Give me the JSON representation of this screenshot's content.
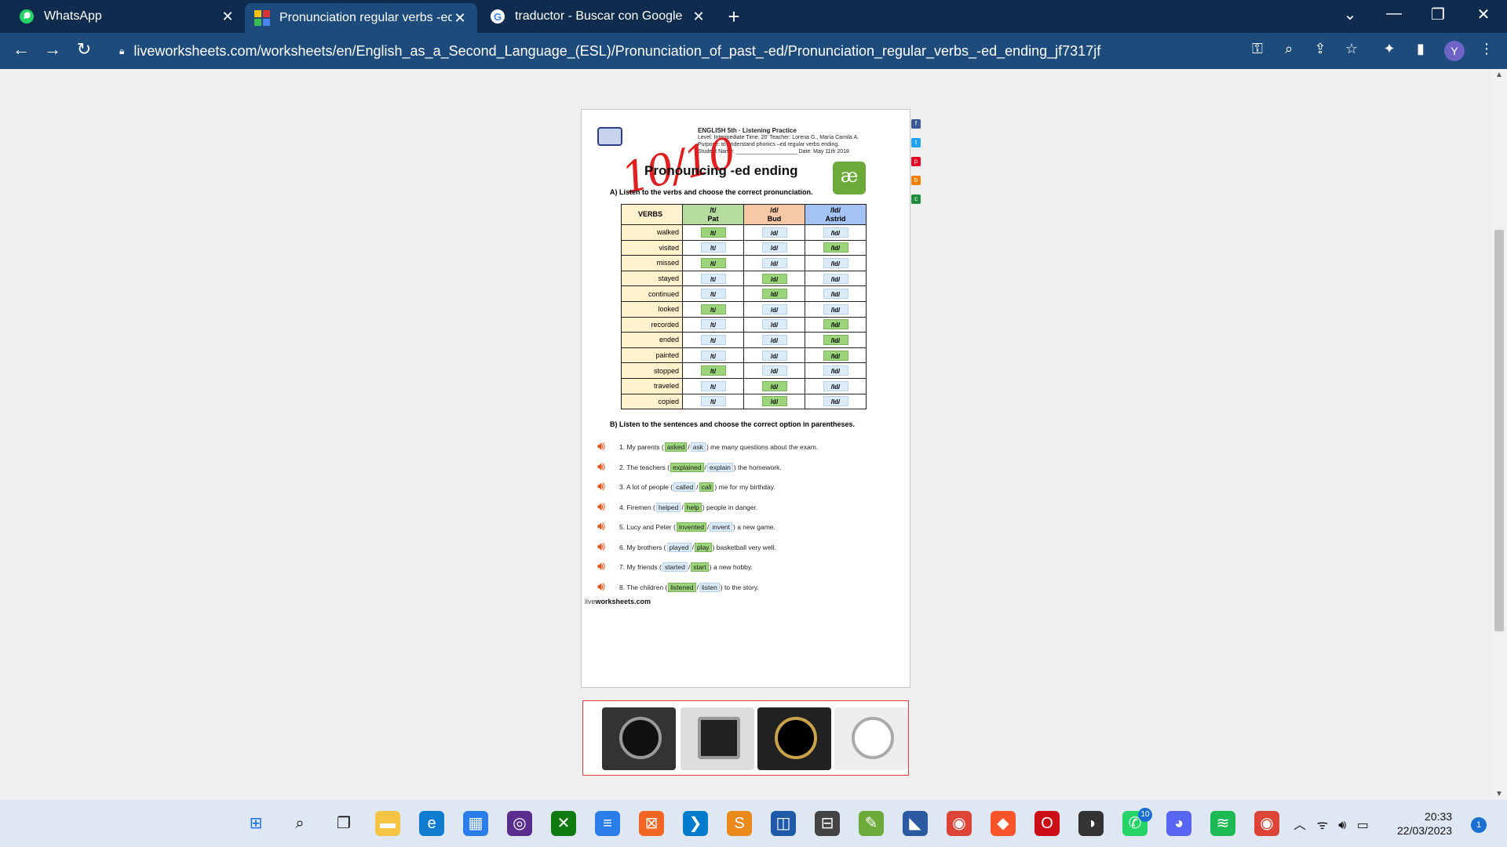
{
  "browser": {
    "tabs": [
      {
        "label": "WhatsApp",
        "icon": "whatsapp-icon"
      },
      {
        "label": "Pronunciation regular verbs -ed e",
        "icon": "liveworksheets-icon",
        "active": true
      },
      {
        "label": "traductor - Buscar con Google",
        "icon": "google-icon"
      }
    ],
    "url": "liveworksheets.com/worksheets/en/English_as_a_Second_Language_(ESL)/Pronunciation_of_past_-ed/Pronunciation_regular_verbs_-ed_ending_jf7317jf",
    "avatar": "Y"
  },
  "worksheet": {
    "header_line1": "ENGLISH 5th · Listening Practice",
    "header_line2": "Level: Intermediate      Time: 20'      Teacher: Lorena G., María Camila A.",
    "header_line3": "Purpose: to understand phonics –ed regular verbs ending.",
    "header_line4": "Student Name: ____________________   Date: May 11th 2018",
    "score": "10/10",
    "title": "Pronouncing -ed ending",
    "ae_logo": "æ",
    "instruction_a": "A) Listen to the verbs and choose the correct pronunciation.",
    "table_headers": [
      "VERBS",
      "/t/\nPat",
      "/d/\nBud",
      "/Id/\nAstrid"
    ],
    "pills": [
      "/t/",
      "/d/",
      "/Id/"
    ],
    "verbs": [
      {
        "verb": "walked",
        "answer": 0
      },
      {
        "verb": "visited",
        "answer": 2
      },
      {
        "verb": "missed",
        "answer": 0
      },
      {
        "verb": "stayed",
        "answer": 1
      },
      {
        "verb": "continued",
        "answer": 1
      },
      {
        "verb": "looked",
        "answer": 0
      },
      {
        "verb": "recorded",
        "answer": 2
      },
      {
        "verb": "ended",
        "answer": 2
      },
      {
        "verb": "painted",
        "answer": 2
      },
      {
        "verb": "stopped",
        "answer": 0
      },
      {
        "verb": "traveled",
        "answer": 1
      },
      {
        "verb": "copied",
        "answer": 1
      }
    ],
    "instruction_b": "B) Listen to the sentences and choose the correct option in parentheses.",
    "sentences": [
      {
        "pre": "1.  My parents (",
        "opt1": "asked",
        "opt2": "ask",
        "post": ") me many questions about the exam.",
        "sel": 0
      },
      {
        "pre": "2.  The teachers  (",
        "opt1": "explained",
        "opt2": "explain",
        "post": ") the homework.",
        "sel": 0
      },
      {
        "pre": "3.  A lot of people (",
        "opt1": "called",
        "opt2": "call",
        "post": ") me for my birthday.",
        "sel": 1
      },
      {
        "pre": "4.  Firemen (",
        "opt1": "helped",
        "opt2": "help",
        "post": ") people in danger.",
        "sel": 1
      },
      {
        "pre": "5.  Lucy and Peter (",
        "opt1": "invented",
        "opt2": "invent",
        "post": ") a new game.",
        "sel": 0
      },
      {
        "pre": "6.  My brothers (",
        "opt1": "played",
        "opt2": "play",
        "post": ") basketball very well.",
        "sel": 1
      },
      {
        "pre": "7.  My friends (",
        "opt1": "started",
        "opt2": "start",
        "post": ") a new hobby.",
        "sel": 1
      },
      {
        "pre": "8.  The children (",
        "opt1": "listened",
        "opt2": "listen",
        "post": ") to the story.",
        "sel": 0
      }
    ],
    "footer_live": "live",
    "footer_rest": "worksheets.com"
  },
  "taskbar": {
    "time": "20:33",
    "date": "22/03/2023",
    "notifications": "1",
    "whatsapp_badge": "10"
  }
}
